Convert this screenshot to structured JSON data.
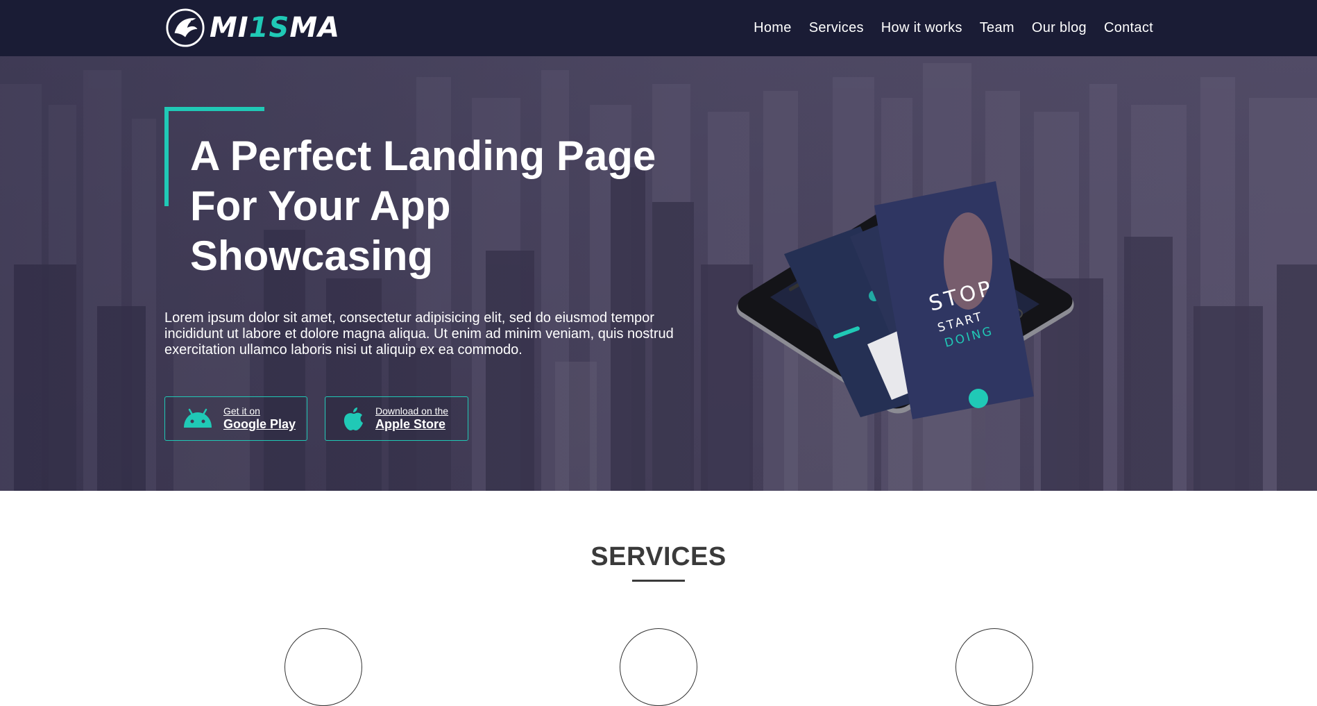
{
  "brand": {
    "logo_prefix": "MI",
    "logo_accent": "1S",
    "logo_suffix": "MA",
    "accent_color": "#20c9b6",
    "nav_bg": "#1a1c35"
  },
  "nav": {
    "items": [
      "Home",
      "Services",
      "How it works",
      "Team",
      "Our blog",
      "Contact"
    ]
  },
  "hero": {
    "title_line1": "A Perfect Landing Page",
    "title_line2": "For Your App",
    "title_line3": "Showcasing",
    "description": "Lorem ipsum dolor sit amet, consectetur adipisicing elit, sed do eiusmod tempor incididunt ut labore et dolore magna aliqua. Ut enim ad minim veniam, quis nostrud exercitation ullamco laboris nisi ut aliquip ex ea commodo.",
    "google_button": {
      "small": "Get it on",
      "big": "Google Play",
      "icon": "android-icon"
    },
    "apple_button": {
      "small": "Download on the",
      "big": "Apple Store",
      "icon": "apple-icon"
    },
    "phone_screen": {
      "line1": "STOP",
      "line2": "START",
      "line3": "DOING"
    }
  },
  "services": {
    "title": "SERVICES"
  }
}
